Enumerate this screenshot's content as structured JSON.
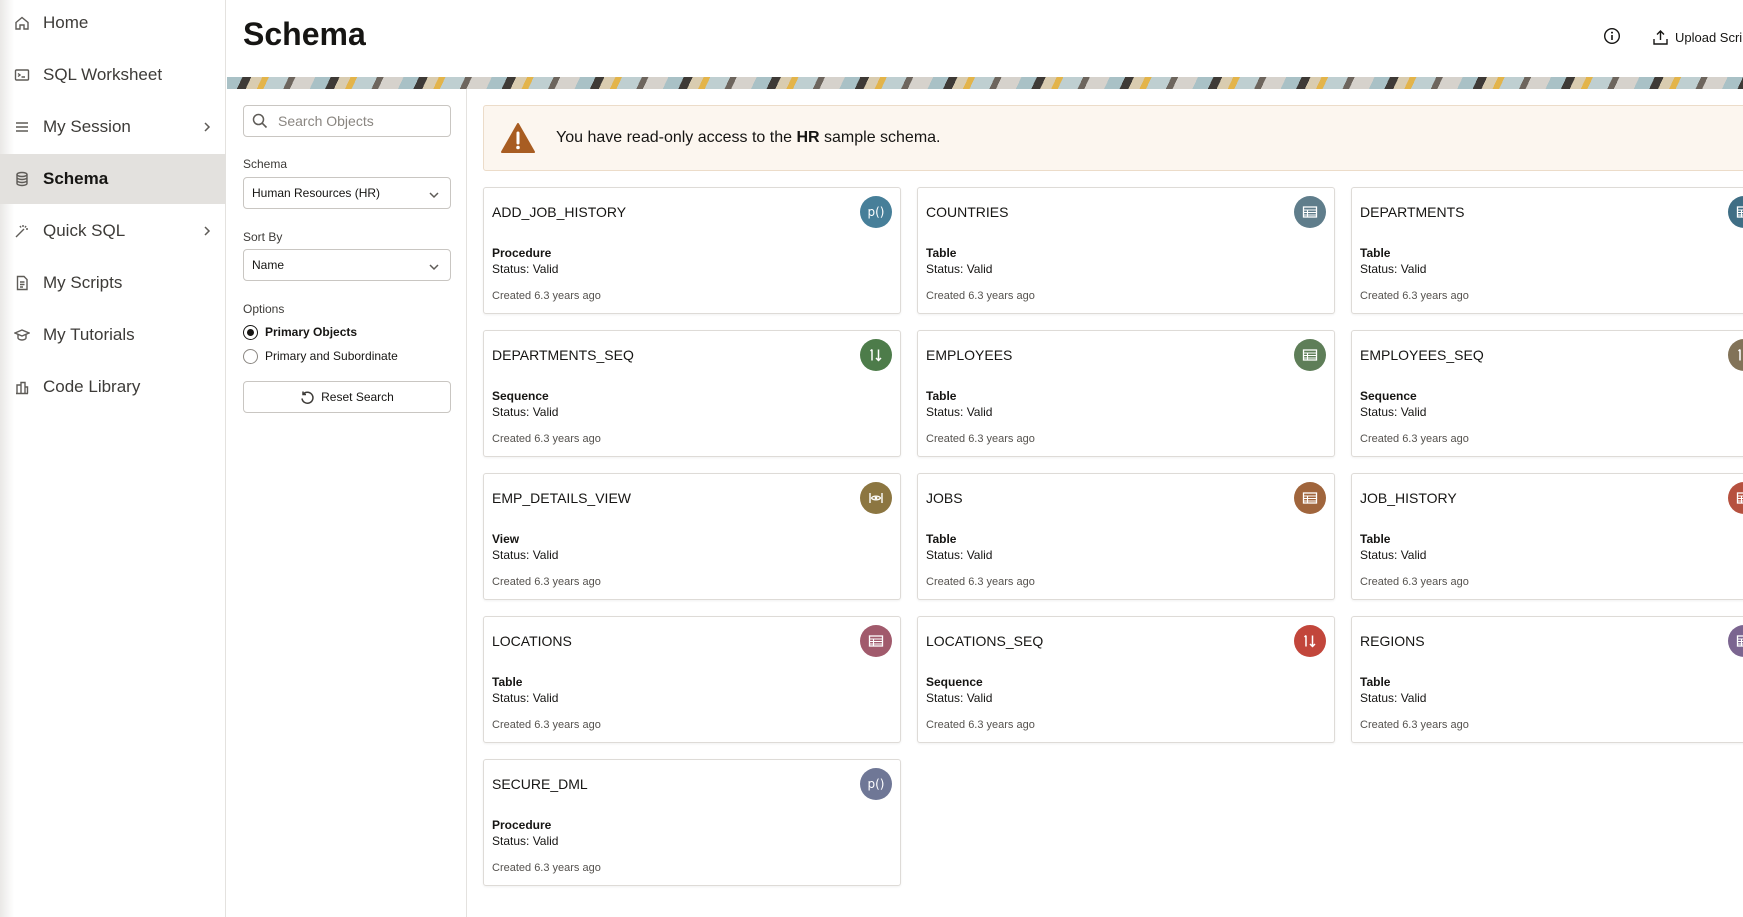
{
  "sidebar": {
    "items": [
      {
        "label": "Home",
        "icon": "home-icon"
      },
      {
        "label": "SQL Worksheet",
        "icon": "terminal-icon"
      },
      {
        "label": "My Session",
        "icon": "list-icon",
        "has_submenu": true
      },
      {
        "label": "Schema",
        "icon": "database-icon",
        "active": true
      },
      {
        "label": "Quick SQL",
        "icon": "magic-wand-icon",
        "has_submenu": true
      },
      {
        "label": "My Scripts",
        "icon": "document-icon"
      },
      {
        "label": "My Tutorials",
        "icon": "graduation-cap-icon"
      },
      {
        "label": "Code Library",
        "icon": "library-icon"
      }
    ]
  },
  "header": {
    "title": "Schema",
    "upload_label": "Upload Scri"
  },
  "filters": {
    "search_placeholder": "Search Objects",
    "schema_label": "Schema",
    "schema_value": "Human Resources (HR)",
    "sort_label": "Sort By",
    "sort_value": "Name",
    "options_label": "Options",
    "option_primary": "Primary Objects",
    "option_primary_subordinate": "Primary and Subordinate",
    "selected_option": "Primary Objects",
    "reset_label": "Reset Search"
  },
  "alert": {
    "prefix": "You have read-only access to the ",
    "schema": "HR",
    "suffix": " sample schema."
  },
  "colors": {
    "procedure_blue": "#477f99",
    "table_slate": "#5f7d8b",
    "table_teal": "#3f6e85",
    "sequence_green": "#4d7c4a",
    "table_green": "#5e7e58",
    "sequence_olive": "#827358",
    "view_olive": "#8c7641",
    "table_orange": "#a0653c",
    "table_red": "#b6513f",
    "table_rose": "#a15a6c",
    "sequence_red": "#c2463b",
    "table_purple": "#7b6590",
    "procedure_slate": "#6f7796"
  },
  "objects": [
    {
      "name": "ADD_JOB_HISTORY",
      "type": "Procedure",
      "status": "Status: Valid",
      "created": "Created 6.3 years ago",
      "icon": "procedure-icon",
      "color": "#477f99"
    },
    {
      "name": "COUNTRIES",
      "type": "Table",
      "status": "Status: Valid",
      "created": "Created 6.3 years ago",
      "icon": "table-icon",
      "color": "#5f7d8b"
    },
    {
      "name": "DEPARTMENTS",
      "type": "Table",
      "status": "Status: Valid",
      "created": "Created 6.3 years ago",
      "icon": "table-icon",
      "color": "#3f6e85"
    },
    {
      "name": "DEPARTMENTS_SEQ",
      "type": "Sequence",
      "status": "Status: Valid",
      "created": "Created 6.3 years ago",
      "icon": "sequence-icon",
      "color": "#4d7c4a"
    },
    {
      "name": "EMPLOYEES",
      "type": "Table",
      "status": "Status: Valid",
      "created": "Created 6.3 years ago",
      "icon": "table-icon",
      "color": "#5e7e58"
    },
    {
      "name": "EMPLOYEES_SEQ",
      "type": "Sequence",
      "status": "Status: Valid",
      "created": "Created 6.3 years ago",
      "icon": "sequence-icon",
      "color": "#827358"
    },
    {
      "name": "EMP_DETAILS_VIEW",
      "type": "View",
      "status": "Status: Valid",
      "created": "Created 6.3 years ago",
      "icon": "view-icon",
      "color": "#8c7641"
    },
    {
      "name": "JOBS",
      "type": "Table",
      "status": "Status: Valid",
      "created": "Created 6.3 years ago",
      "icon": "table-icon",
      "color": "#a0653c"
    },
    {
      "name": "JOB_HISTORY",
      "type": "Table",
      "status": "Status: Valid",
      "created": "Created 6.3 years ago",
      "icon": "table-icon",
      "color": "#b6513f"
    },
    {
      "name": "LOCATIONS",
      "type": "Table",
      "status": "Status: Valid",
      "created": "Created 6.3 years ago",
      "icon": "table-icon",
      "color": "#a15a6c"
    },
    {
      "name": "LOCATIONS_SEQ",
      "type": "Sequence",
      "status": "Status: Valid",
      "created": "Created 6.3 years ago",
      "icon": "sequence-icon",
      "color": "#c2463b"
    },
    {
      "name": "REGIONS",
      "type": "Table",
      "status": "Status: Valid",
      "created": "Created 6.3 years ago",
      "icon": "table-icon",
      "color": "#7b6590"
    },
    {
      "name": "SECURE_DML",
      "type": "Procedure",
      "status": "Status: Valid",
      "created": "Created 6.3 years ago",
      "icon": "procedure-icon",
      "color": "#6f7796"
    }
  ]
}
